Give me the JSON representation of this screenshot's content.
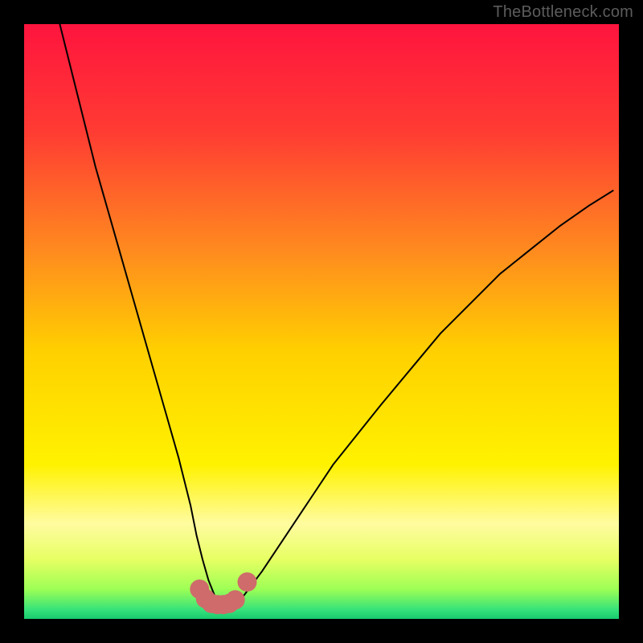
{
  "watermark": "TheBottleneck.com",
  "gradient_stops": [
    {
      "offset": 0.0,
      "color": "#ff143e"
    },
    {
      "offset": 0.18,
      "color": "#ff3b33"
    },
    {
      "offset": 0.38,
      "color": "#ff8a1f"
    },
    {
      "offset": 0.55,
      "color": "#ffd000"
    },
    {
      "offset": 0.74,
      "color": "#fff200"
    },
    {
      "offset": 0.84,
      "color": "#fffca0"
    },
    {
      "offset": 0.9,
      "color": "#e7ff63"
    },
    {
      "offset": 0.95,
      "color": "#9dff55"
    },
    {
      "offset": 0.985,
      "color": "#35e27a"
    },
    {
      "offset": 1.0,
      "color": "#18c96f"
    }
  ],
  "chart_data": {
    "type": "line",
    "title": "",
    "xlabel": "",
    "ylabel": "",
    "xlim": [
      0,
      100
    ],
    "ylim": [
      0,
      100
    ],
    "grid": false,
    "legend": false,
    "series": [
      {
        "name": "bottleneck-curve",
        "color": "#000000",
        "stroke_width": 2,
        "x": [
          6,
          8,
          10,
          12,
          14,
          16,
          18,
          20,
          22,
          24,
          26,
          28,
          29,
          30,
          31,
          32,
          33,
          34,
          35,
          37,
          40,
          44,
          48,
          52,
          56,
          60,
          65,
          70,
          75,
          80,
          85,
          90,
          95,
          99
        ],
        "y": [
          100,
          92,
          84,
          76,
          69,
          62,
          55,
          48,
          41,
          34,
          27,
          19,
          14,
          10,
          6.5,
          4,
          2.5,
          2.3,
          2.5,
          4,
          8,
          14,
          20,
          26,
          31,
          36,
          42,
          48,
          53,
          58,
          62,
          66,
          69.5,
          72
        ]
      },
      {
        "name": "highlight-markers",
        "type": "scatter",
        "color": "#cf6b6b",
        "marker_size": 12,
        "x": [
          29.5,
          30.5,
          31.5,
          32.5,
          33.5,
          34.5,
          35.5,
          37.5
        ],
        "y": [
          5.0,
          3.4,
          2.6,
          2.4,
          2.4,
          2.6,
          3.2,
          6.2
        ]
      }
    ]
  }
}
